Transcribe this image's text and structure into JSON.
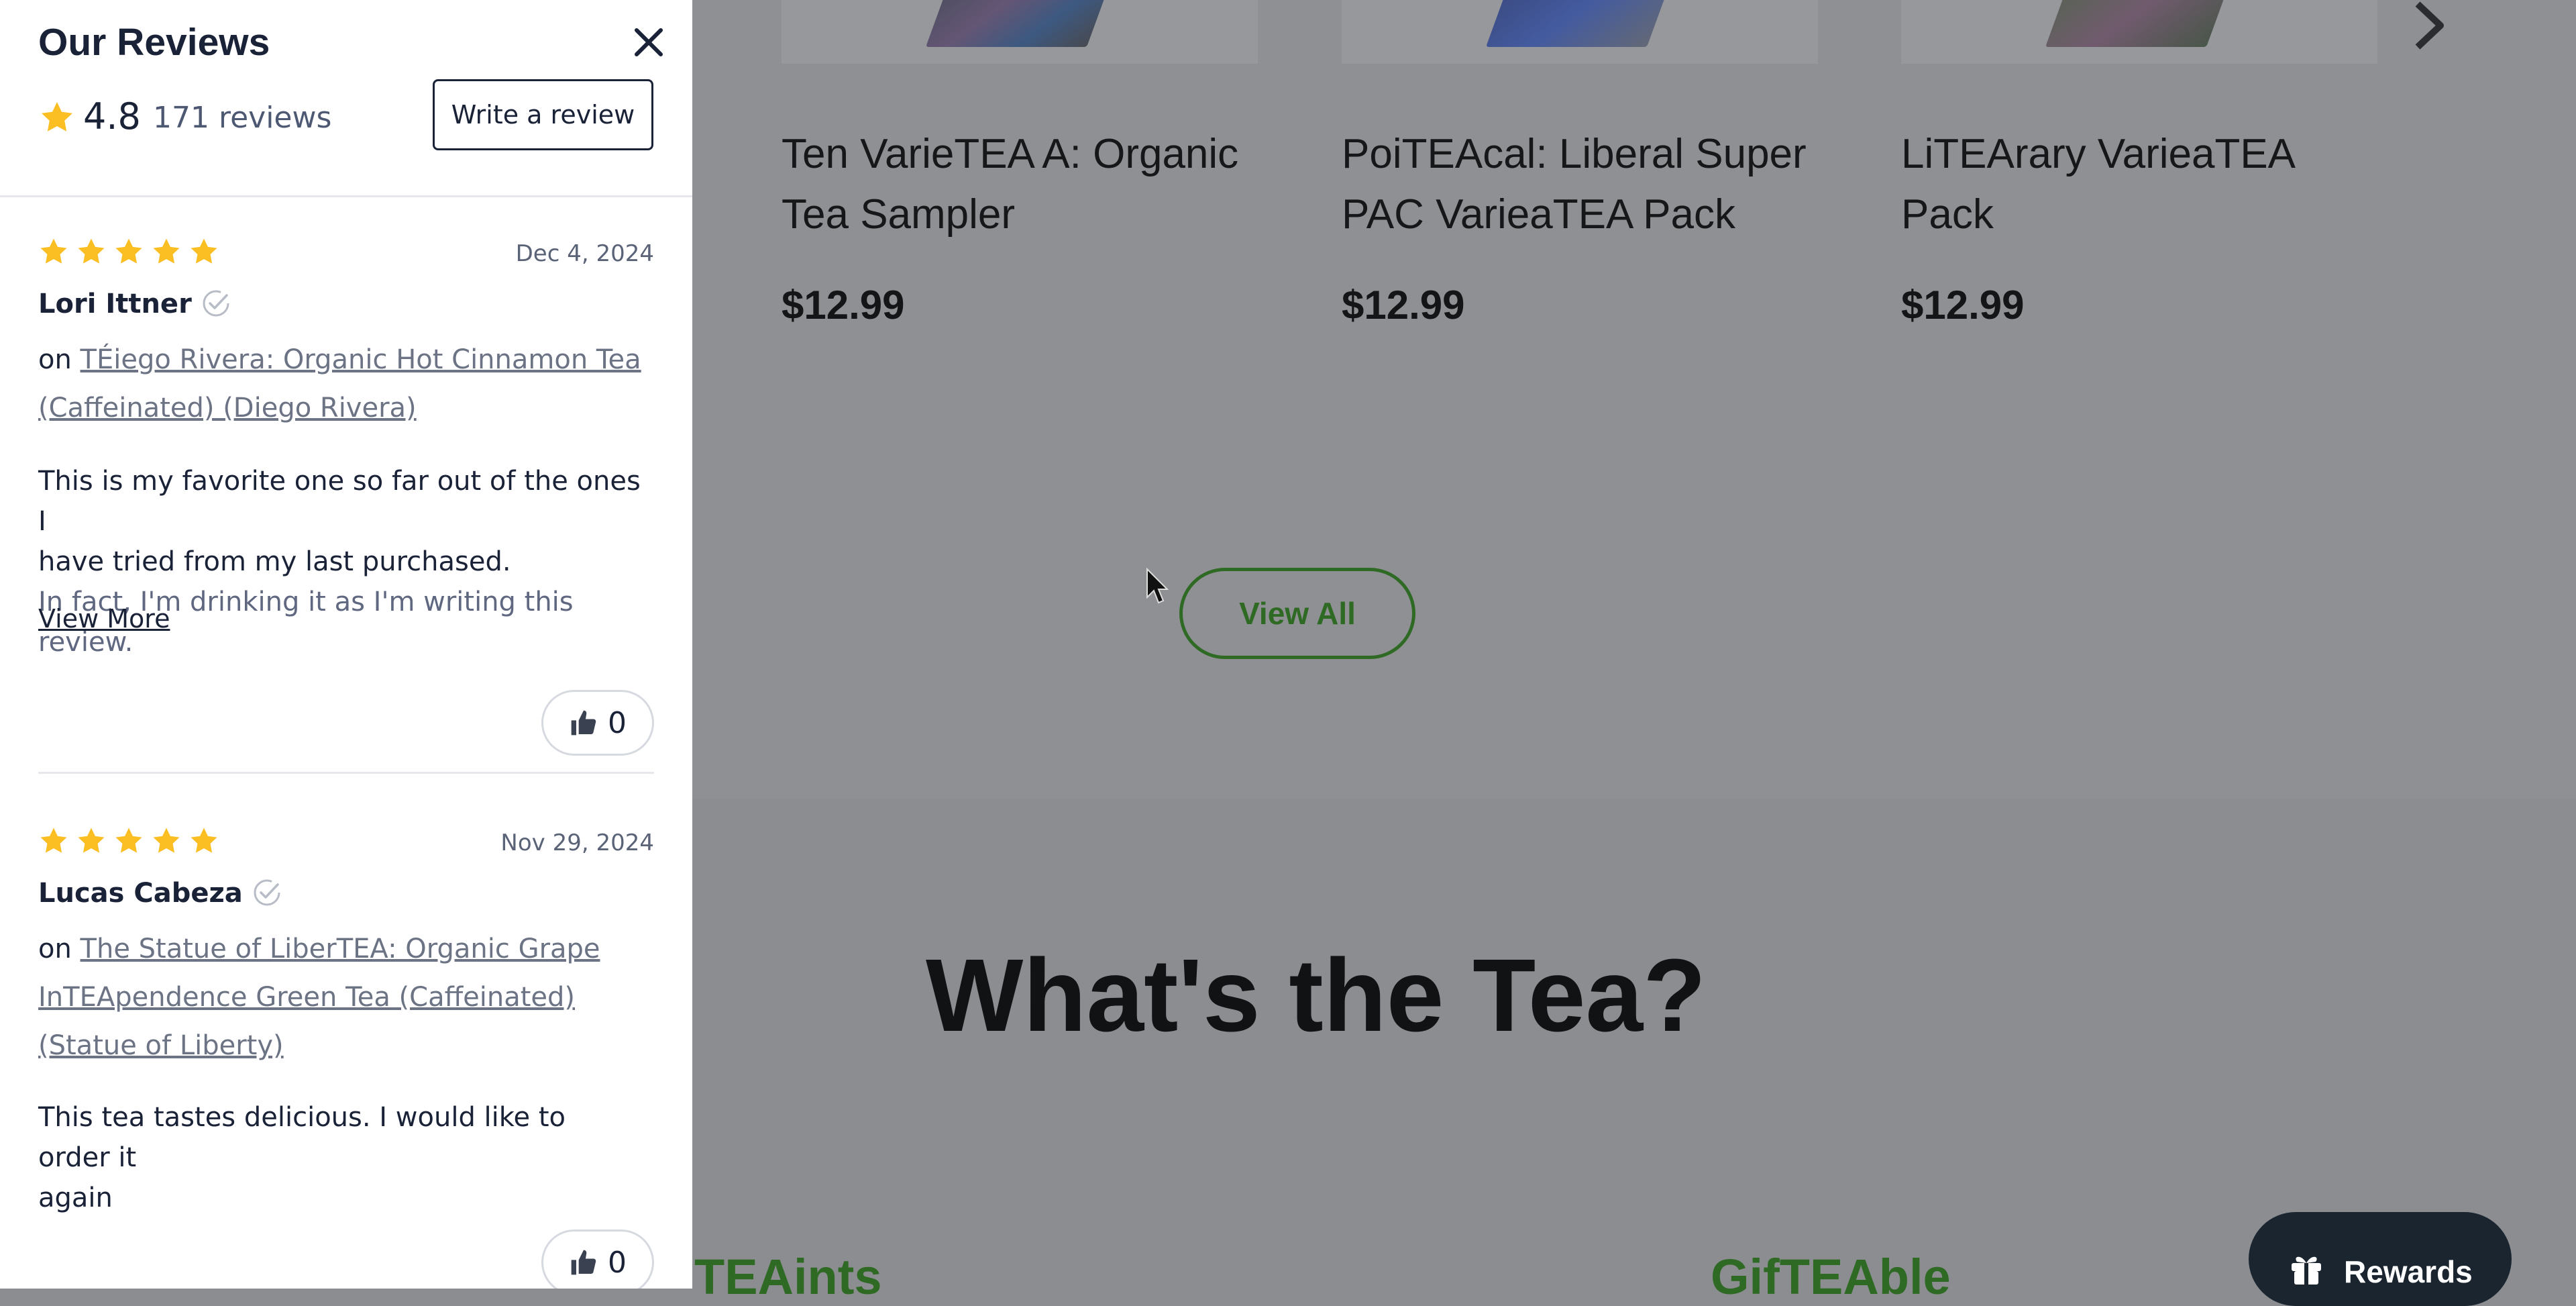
{
  "background_page": {
    "products": [
      {
        "name": "Ten VarieTEA A: Organic Tea Sampler",
        "name_line1": "Ten VarieTEA A: Organic",
        "name_line2": "Tea Sampler",
        "price": "$12.99"
      },
      {
        "name": "PoiTEAcal: Liberal Super PAC VarieaTEA Pack",
        "name_line1": "PoiTEAcal: Liberal Super",
        "name_line2": "PAC VarieaTEA Pack",
        "price": "$12.99"
      },
      {
        "name": "LiTEArary VarieaTEA Pack",
        "name_line1": "LiTEArary VarieaTEA",
        "name_line2": "Pack",
        "price": "$12.99"
      }
    ],
    "view_all_label": "View All",
    "section_heading": "What's the Tea?",
    "section_links": [
      "TEAints",
      "GifTEAble"
    ],
    "rewards_label": "Rewards",
    "accent_color": "#2f6a24"
  },
  "reviews_panel": {
    "title": "Our Reviews",
    "rating": "4.8",
    "review_count": "171 reviews",
    "write_review_label": "Write a review",
    "star_color": "#fbbf24",
    "reviews": [
      {
        "stars": 5,
        "date": "Dec 4, 2024",
        "reviewer": "Lori Ittner",
        "on_label": "on",
        "product": "TÉiego Rivera: Organic Hot Cinnamon Tea (Caffeinated) (Diego Rivera)",
        "body_line1": "This is my favorite one so far out of the ones I",
        "body_line2": "have tried from my last purchased.",
        "body_line3": "In fact, I'm drinking it as I'm writing this review.",
        "view_more_label": "View More",
        "helpful_count": "0"
      },
      {
        "stars": 5,
        "date": "Nov 29, 2024",
        "reviewer": "Lucas Cabeza",
        "on_label": "on",
        "product": "The Statue of LiberTEA: Organic Grape InTEApendence Green Tea (Caffeinated) (Statue of Liberty)",
        "body_line1": "This tea tastes delicious. I would like to order it",
        "body_line2": "again",
        "helpful_count": "0"
      }
    ]
  }
}
